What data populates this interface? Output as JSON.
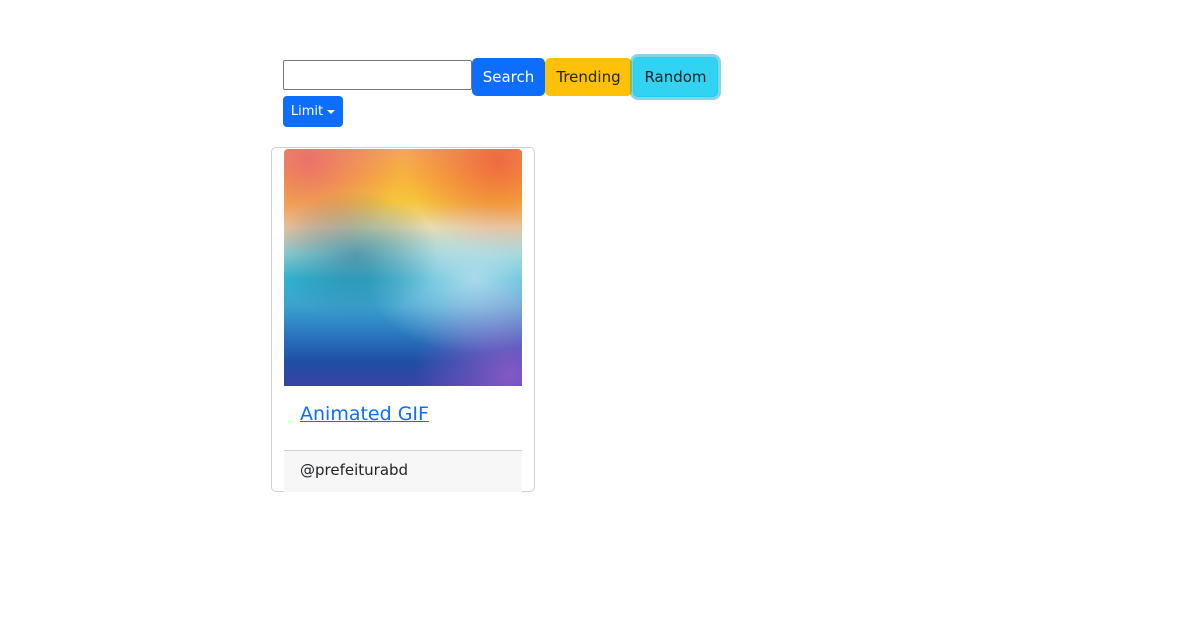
{
  "search": {
    "input_value": "",
    "input_placeholder": "",
    "search_label": "Search",
    "trending_label": "Trending",
    "random_label": "Random",
    "limit_label": "Limit"
  },
  "colors": {
    "primary": "#0d6efd",
    "warning": "#ffc107",
    "info": "#31d2f2"
  },
  "results": [
    {
      "title": "Animated GIF",
      "user": "@prefeiturabd",
      "image_icon": "watercolor-gradient-image"
    }
  ]
}
